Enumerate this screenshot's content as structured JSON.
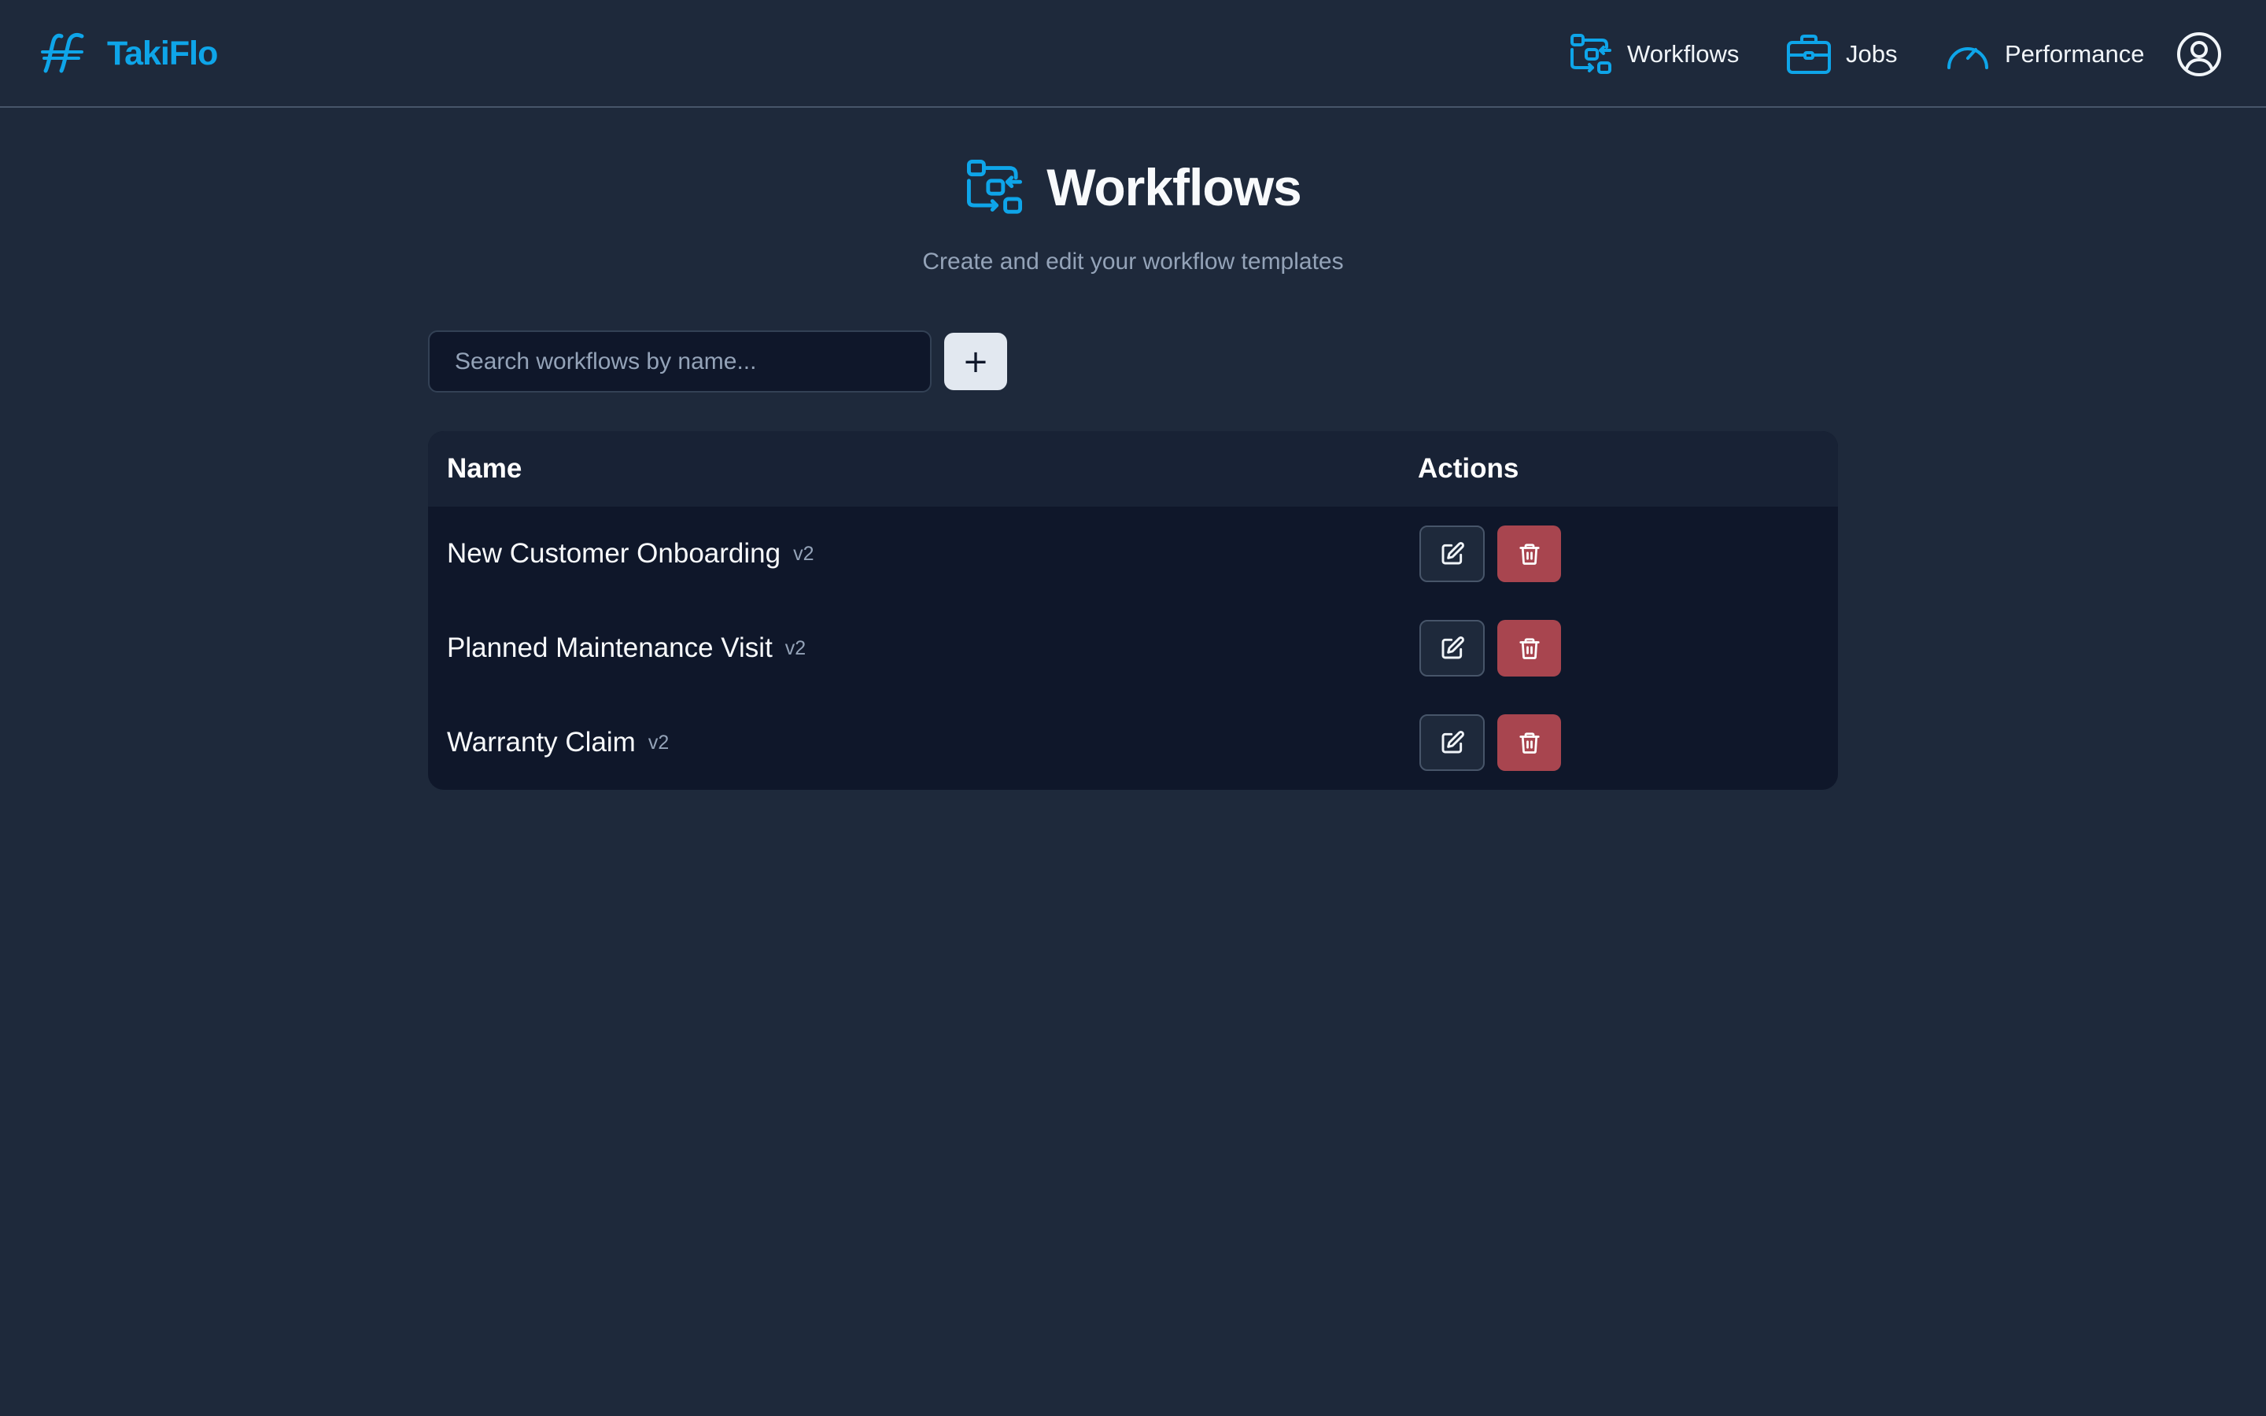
{
  "app": {
    "name": "TakiFlo",
    "brand_color": "#0ea5e9"
  },
  "nav": {
    "items": [
      {
        "label": "Workflows",
        "icon": "workflow-icon"
      },
      {
        "label": "Jobs",
        "icon": "briefcase-icon"
      },
      {
        "label": "Performance",
        "icon": "gauge-icon"
      }
    ],
    "account_icon": "user-circle-icon"
  },
  "page": {
    "title": "Workflows",
    "title_icon": "workflow-icon",
    "subtitle": "Create and edit your workflow templates"
  },
  "search": {
    "placeholder": "Search workflows by name...",
    "value": ""
  },
  "add_button": {
    "label": "+"
  },
  "table": {
    "columns": [
      "Name",
      "Actions"
    ],
    "rows": [
      {
        "name": "New Customer Onboarding",
        "version": "v2"
      },
      {
        "name": "Planned Maintenance Visit",
        "version": "v2"
      },
      {
        "name": "Warranty Claim",
        "version": "v2"
      }
    ],
    "actions": [
      "edit-icon",
      "trash-icon"
    ]
  },
  "colors": {
    "background": "#1e293b",
    "accent": "#0ea5e9",
    "danger": "#a8454f",
    "panel": "#0f172a"
  }
}
